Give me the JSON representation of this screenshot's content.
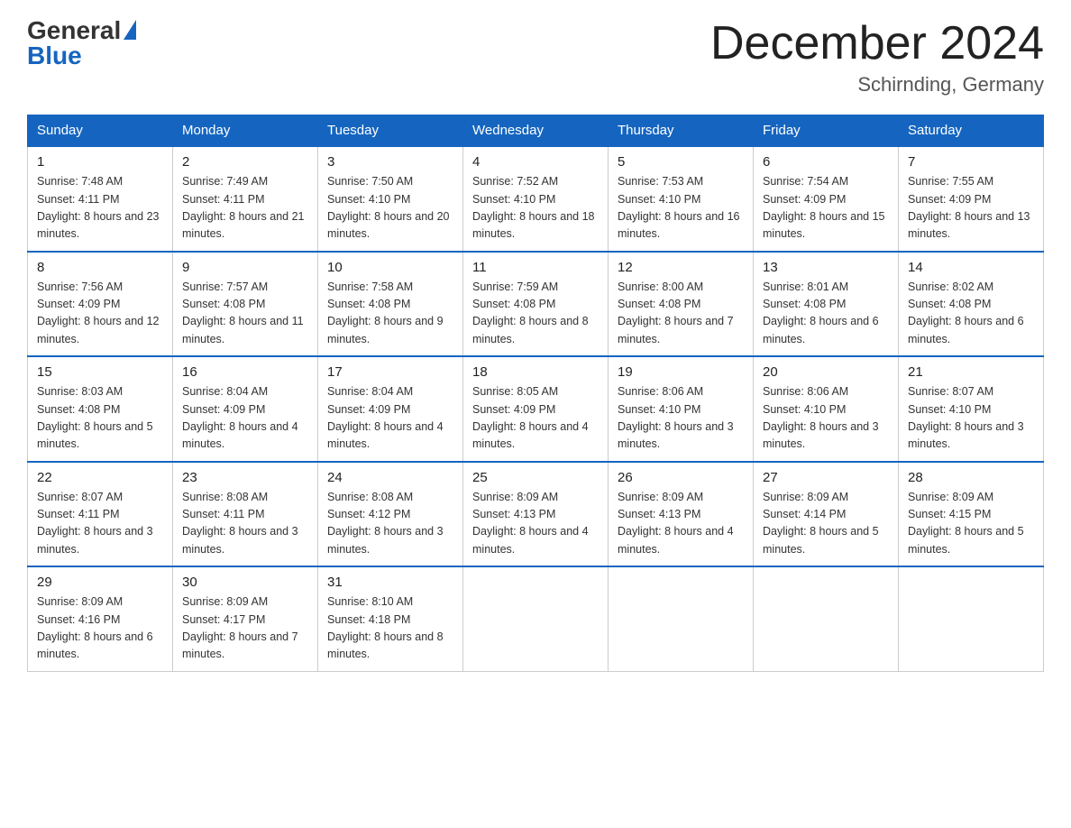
{
  "header": {
    "logo_text_general": "General",
    "logo_text_blue": "Blue",
    "month_title": "December 2024",
    "location": "Schirnding, Germany"
  },
  "weekdays": [
    "Sunday",
    "Monday",
    "Tuesday",
    "Wednesday",
    "Thursday",
    "Friday",
    "Saturday"
  ],
  "weeks": [
    [
      {
        "day": "1",
        "sunrise": "7:48 AM",
        "sunset": "4:11 PM",
        "daylight": "8 hours and 23 minutes."
      },
      {
        "day": "2",
        "sunrise": "7:49 AM",
        "sunset": "4:11 PM",
        "daylight": "8 hours and 21 minutes."
      },
      {
        "day": "3",
        "sunrise": "7:50 AM",
        "sunset": "4:10 PM",
        "daylight": "8 hours and 20 minutes."
      },
      {
        "day": "4",
        "sunrise": "7:52 AM",
        "sunset": "4:10 PM",
        "daylight": "8 hours and 18 minutes."
      },
      {
        "day": "5",
        "sunrise": "7:53 AM",
        "sunset": "4:10 PM",
        "daylight": "8 hours and 16 minutes."
      },
      {
        "day": "6",
        "sunrise": "7:54 AM",
        "sunset": "4:09 PM",
        "daylight": "8 hours and 15 minutes."
      },
      {
        "day": "7",
        "sunrise": "7:55 AM",
        "sunset": "4:09 PM",
        "daylight": "8 hours and 13 minutes."
      }
    ],
    [
      {
        "day": "8",
        "sunrise": "7:56 AM",
        "sunset": "4:09 PM",
        "daylight": "8 hours and 12 minutes."
      },
      {
        "day": "9",
        "sunrise": "7:57 AM",
        "sunset": "4:08 PM",
        "daylight": "8 hours and 11 minutes."
      },
      {
        "day": "10",
        "sunrise": "7:58 AM",
        "sunset": "4:08 PM",
        "daylight": "8 hours and 9 minutes."
      },
      {
        "day": "11",
        "sunrise": "7:59 AM",
        "sunset": "4:08 PM",
        "daylight": "8 hours and 8 minutes."
      },
      {
        "day": "12",
        "sunrise": "8:00 AM",
        "sunset": "4:08 PM",
        "daylight": "8 hours and 7 minutes."
      },
      {
        "day": "13",
        "sunrise": "8:01 AM",
        "sunset": "4:08 PM",
        "daylight": "8 hours and 6 minutes."
      },
      {
        "day": "14",
        "sunrise": "8:02 AM",
        "sunset": "4:08 PM",
        "daylight": "8 hours and 6 minutes."
      }
    ],
    [
      {
        "day": "15",
        "sunrise": "8:03 AM",
        "sunset": "4:08 PM",
        "daylight": "8 hours and 5 minutes."
      },
      {
        "day": "16",
        "sunrise": "8:04 AM",
        "sunset": "4:09 PM",
        "daylight": "8 hours and 4 minutes."
      },
      {
        "day": "17",
        "sunrise": "8:04 AM",
        "sunset": "4:09 PM",
        "daylight": "8 hours and 4 minutes."
      },
      {
        "day": "18",
        "sunrise": "8:05 AM",
        "sunset": "4:09 PM",
        "daylight": "8 hours and 4 minutes."
      },
      {
        "day": "19",
        "sunrise": "8:06 AM",
        "sunset": "4:10 PM",
        "daylight": "8 hours and 3 minutes."
      },
      {
        "day": "20",
        "sunrise": "8:06 AM",
        "sunset": "4:10 PM",
        "daylight": "8 hours and 3 minutes."
      },
      {
        "day": "21",
        "sunrise": "8:07 AM",
        "sunset": "4:10 PM",
        "daylight": "8 hours and 3 minutes."
      }
    ],
    [
      {
        "day": "22",
        "sunrise": "8:07 AM",
        "sunset": "4:11 PM",
        "daylight": "8 hours and 3 minutes."
      },
      {
        "day": "23",
        "sunrise": "8:08 AM",
        "sunset": "4:11 PM",
        "daylight": "8 hours and 3 minutes."
      },
      {
        "day": "24",
        "sunrise": "8:08 AM",
        "sunset": "4:12 PM",
        "daylight": "8 hours and 3 minutes."
      },
      {
        "day": "25",
        "sunrise": "8:09 AM",
        "sunset": "4:13 PM",
        "daylight": "8 hours and 4 minutes."
      },
      {
        "day": "26",
        "sunrise": "8:09 AM",
        "sunset": "4:13 PM",
        "daylight": "8 hours and 4 minutes."
      },
      {
        "day": "27",
        "sunrise": "8:09 AM",
        "sunset": "4:14 PM",
        "daylight": "8 hours and 5 minutes."
      },
      {
        "day": "28",
        "sunrise": "8:09 AM",
        "sunset": "4:15 PM",
        "daylight": "8 hours and 5 minutes."
      }
    ],
    [
      {
        "day": "29",
        "sunrise": "8:09 AM",
        "sunset": "4:16 PM",
        "daylight": "8 hours and 6 minutes."
      },
      {
        "day": "30",
        "sunrise": "8:09 AM",
        "sunset": "4:17 PM",
        "daylight": "8 hours and 7 minutes."
      },
      {
        "day": "31",
        "sunrise": "8:10 AM",
        "sunset": "4:18 PM",
        "daylight": "8 hours and 8 minutes."
      },
      null,
      null,
      null,
      null
    ]
  ]
}
